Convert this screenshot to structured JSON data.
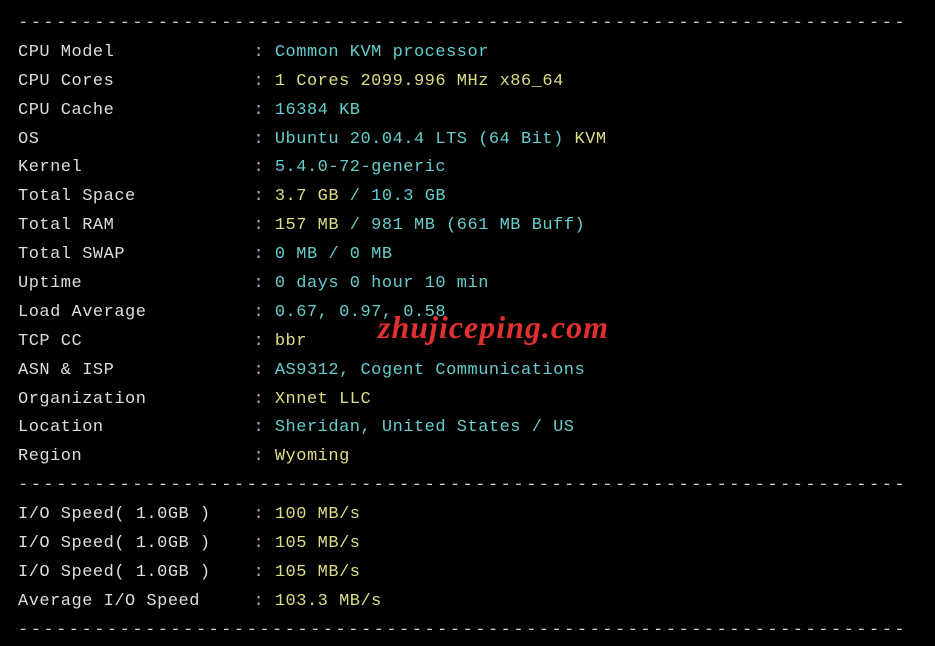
{
  "divider": "----------------------------------------------------------------------",
  "rows": [
    {
      "label": "CPU Model            ",
      "parts": [
        {
          "cls": "cyan",
          "text": "Common KVM processor"
        }
      ]
    },
    {
      "label": "CPU Cores            ",
      "parts": [
        {
          "cls": "yellow",
          "text": "1 Cores 2099.996 MHz x86_64"
        }
      ]
    },
    {
      "label": "CPU Cache            ",
      "parts": [
        {
          "cls": "cyan",
          "text": "16384 KB"
        }
      ]
    },
    {
      "label": "OS                   ",
      "parts": [
        {
          "cls": "cyan",
          "text": "Ubuntu 20.04.4 LTS (64 Bit)"
        },
        {
          "cls": "white",
          "text": " "
        },
        {
          "cls": "yellow",
          "text": "KVM"
        }
      ]
    },
    {
      "label": "Kernel               ",
      "parts": [
        {
          "cls": "cyan",
          "text": "5.4.0-72-generic"
        }
      ]
    },
    {
      "label": "Total Space          ",
      "parts": [
        {
          "cls": "yellow",
          "text": "3.7 GB"
        },
        {
          "cls": "cyan",
          "text": " / 10.3 GB"
        }
      ]
    },
    {
      "label": "Total RAM            ",
      "parts": [
        {
          "cls": "yellow",
          "text": "157 MB"
        },
        {
          "cls": "cyan",
          "text": " / 981 MB (661 MB Buff)"
        }
      ]
    },
    {
      "label": "Total SWAP           ",
      "parts": [
        {
          "cls": "cyan",
          "text": "0 MB / 0 MB"
        }
      ]
    },
    {
      "label": "Uptime               ",
      "parts": [
        {
          "cls": "cyan",
          "text": "0 days 0 hour 10 min"
        }
      ]
    },
    {
      "label": "Load Average         ",
      "parts": [
        {
          "cls": "cyan",
          "text": "0.67, 0.97, 0.58"
        }
      ]
    },
    {
      "label": "TCP CC               ",
      "parts": [
        {
          "cls": "yellow",
          "text": "bbr"
        }
      ]
    },
    {
      "label": "ASN & ISP            ",
      "parts": [
        {
          "cls": "cyan",
          "text": "AS9312, Cogent Communications"
        }
      ]
    },
    {
      "label": "Organization         ",
      "parts": [
        {
          "cls": "yellow",
          "text": "Xnnet LLC"
        }
      ]
    },
    {
      "label": "Location             ",
      "parts": [
        {
          "cls": "cyan",
          "text": "Sheridan, United States / US"
        }
      ]
    },
    {
      "label": "Region               ",
      "parts": [
        {
          "cls": "yellow",
          "text": "Wyoming"
        }
      ]
    }
  ],
  "iorows": [
    {
      "label": "I/O Speed( 1.0GB )   ",
      "parts": [
        {
          "cls": "yellow",
          "text": "100 MB/s"
        }
      ]
    },
    {
      "label": "I/O Speed( 1.0GB )   ",
      "parts": [
        {
          "cls": "yellow",
          "text": "105 MB/s"
        }
      ]
    },
    {
      "label": "I/O Speed( 1.0GB )   ",
      "parts": [
        {
          "cls": "yellow",
          "text": "105 MB/s"
        }
      ]
    },
    {
      "label": "Average I/O Speed    ",
      "parts": [
        {
          "cls": "yellow",
          "text": "103.3 MB/s"
        }
      ]
    }
  ],
  "colon_sep": " : ",
  "watermark": "zhujiceping.com"
}
